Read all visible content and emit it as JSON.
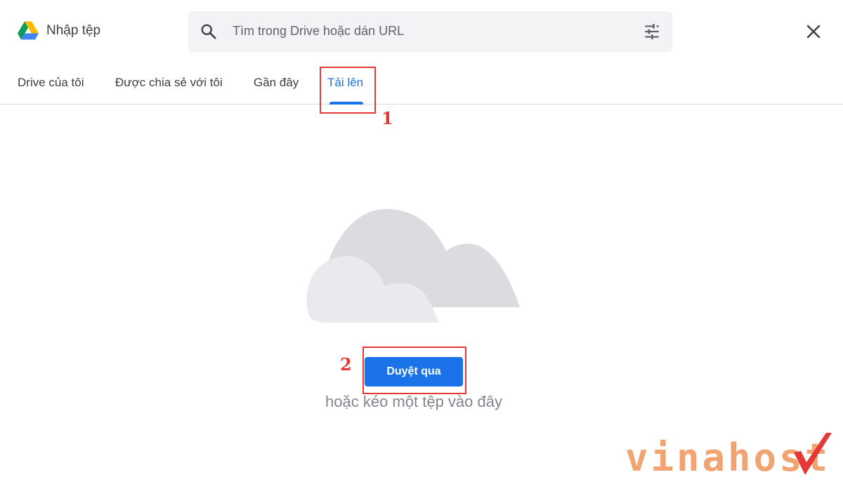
{
  "header": {
    "title": "Nhập tệp",
    "search_placeholder": "Tìm trong Drive hoặc dán URL"
  },
  "tabs": [
    {
      "label": "Drive của tôi",
      "active": false
    },
    {
      "label": "Được chia sẻ với tôi",
      "active": false
    },
    {
      "label": "Gần đây",
      "active": false
    },
    {
      "label": "Tải lên",
      "active": true
    }
  ],
  "annotations": {
    "step1": "1",
    "step2": "2"
  },
  "upload": {
    "browse_label": "Duyệt qua",
    "drop_hint": "hoặc kéo một tệp vào đây"
  },
  "watermark": {
    "brand": "vinahost"
  },
  "colors": {
    "accent": "#1a73e8",
    "annotation": "#e53935",
    "watermark": "#f1a371"
  },
  "icons": [
    "google-drive-logo-icon",
    "search-icon",
    "tune-filter-icon",
    "close-icon",
    "cloud-icon"
  ]
}
